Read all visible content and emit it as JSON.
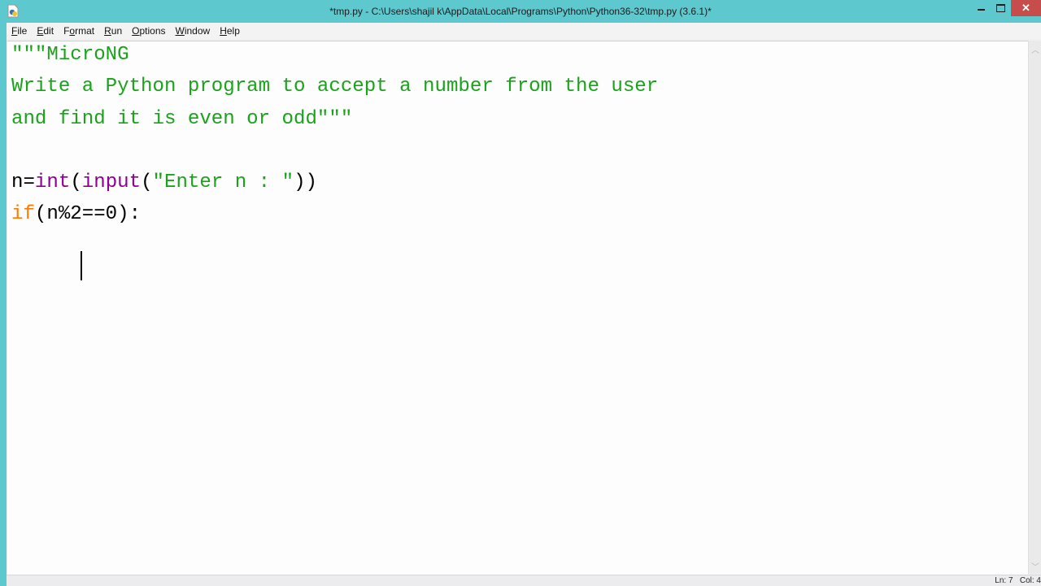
{
  "window": {
    "title": "*tmp.py - C:\\Users\\shajil k\\AppData\\Local\\Programs\\Python\\Python36-32\\tmp.py (3.6.1)*",
    "app_icon": "python-idle-file-icon",
    "controls": {
      "minimize_icon": "minimize-icon",
      "maximize_icon": "maximize-icon",
      "close_label": "✕"
    }
  },
  "menubar": {
    "items": [
      {
        "label": "File",
        "accel": "F",
        "rest": "ile"
      },
      {
        "label": "Edit",
        "accel": "E",
        "rest": "dit"
      },
      {
        "label": "Format",
        "accel_prefix": "F",
        "accel": "o",
        "rest": "rmat"
      },
      {
        "label": "Run",
        "accel": "R",
        "rest": "un"
      },
      {
        "label": "Options",
        "accel": "O",
        "rest": "ptions"
      },
      {
        "label": "Window",
        "accel": "W",
        "rest": "indow"
      },
      {
        "label": "Help",
        "accel": "H",
        "rest": "elp"
      }
    ]
  },
  "editor": {
    "lines": [
      [
        {
          "t": "\"\"\"MicroNG",
          "c": "str"
        }
      ],
      [
        {
          "t": "Write a Python program to accept a number from the user",
          "c": "str"
        }
      ],
      [
        {
          "t": "and find it is even or odd\"\"\"",
          "c": "str"
        }
      ],
      [
        {
          "t": "",
          "c": "plain"
        }
      ],
      [
        {
          "t": "n=",
          "c": "plain"
        },
        {
          "t": "int",
          "c": "builtin"
        },
        {
          "t": "(",
          "c": "plain"
        },
        {
          "t": "input",
          "c": "builtin"
        },
        {
          "t": "(",
          "c": "plain"
        },
        {
          "t": "\"Enter n : \"",
          "c": "str"
        },
        {
          "t": "))",
          "c": "plain"
        }
      ],
      [
        {
          "t": "if",
          "c": "kw"
        },
        {
          "t": "(n%2==0):",
          "c": "plain"
        }
      ],
      [
        {
          "t": "     ",
          "c": "plain"
        }
      ]
    ],
    "colors": {
      "string": "#1aa31a",
      "keyword": "#ff7a00",
      "builtin": "#900090",
      "plain": "#000000"
    }
  },
  "statusbar": {
    "line": "Ln: 7",
    "col": "Col: 4"
  }
}
